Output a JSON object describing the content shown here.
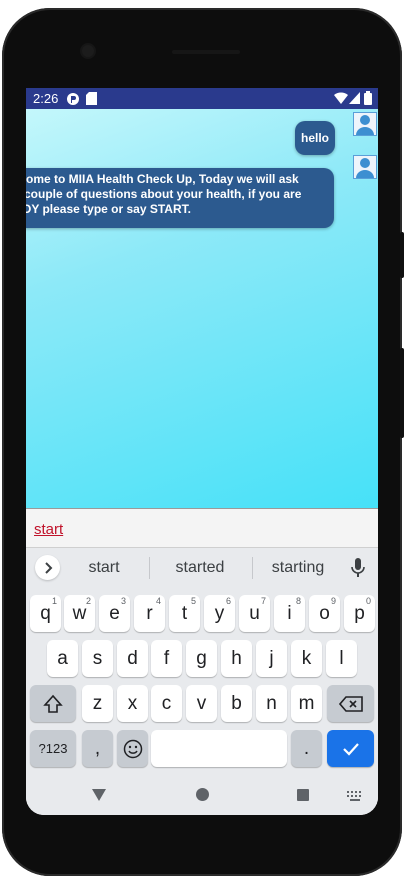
{
  "status_bar": {
    "time": "2:26"
  },
  "chat": {
    "messages": [
      {
        "from": "user",
        "text": "hello"
      },
      {
        "from": "bot",
        "lines": [
          "lcome to MIIA Health Check Up, Today we will ask",
          "a couple of questions about your health, if you are",
          "ADY please type or say START."
        ]
      }
    ]
  },
  "input": {
    "value": "start"
  },
  "keyboard": {
    "suggestions": [
      "start",
      "started",
      "starting"
    ],
    "row1": [
      {
        "k": "q",
        "n": "1"
      },
      {
        "k": "w",
        "n": "2"
      },
      {
        "k": "e",
        "n": "3"
      },
      {
        "k": "r",
        "n": "4"
      },
      {
        "k": "t",
        "n": "5"
      },
      {
        "k": "y",
        "n": "6"
      },
      {
        "k": "u",
        "n": "7"
      },
      {
        "k": "i",
        "n": "8"
      },
      {
        "k": "o",
        "n": "9"
      },
      {
        "k": "p",
        "n": "0"
      }
    ],
    "row2": [
      "a",
      "s",
      "d",
      "f",
      "g",
      "h",
      "j",
      "k",
      "l"
    ],
    "row3": [
      "z",
      "x",
      "c",
      "v",
      "b",
      "n",
      "m"
    ],
    "symbols_label": "?123",
    "comma": ",",
    "period": "."
  },
  "colors": {
    "status_bar": "#2a3a8d",
    "bubble": "#2c5a8f",
    "accent": "#1a73e8",
    "input_text": "#c0122a"
  },
  "icons": [
    "wifi-icon",
    "signal-icon",
    "battery-icon",
    "chevron-right-icon",
    "mic-icon",
    "shift-icon",
    "backspace-icon",
    "emoji-icon",
    "checkmark-icon",
    "back-icon",
    "home-icon",
    "recents-icon",
    "keyboard-icon"
  ]
}
